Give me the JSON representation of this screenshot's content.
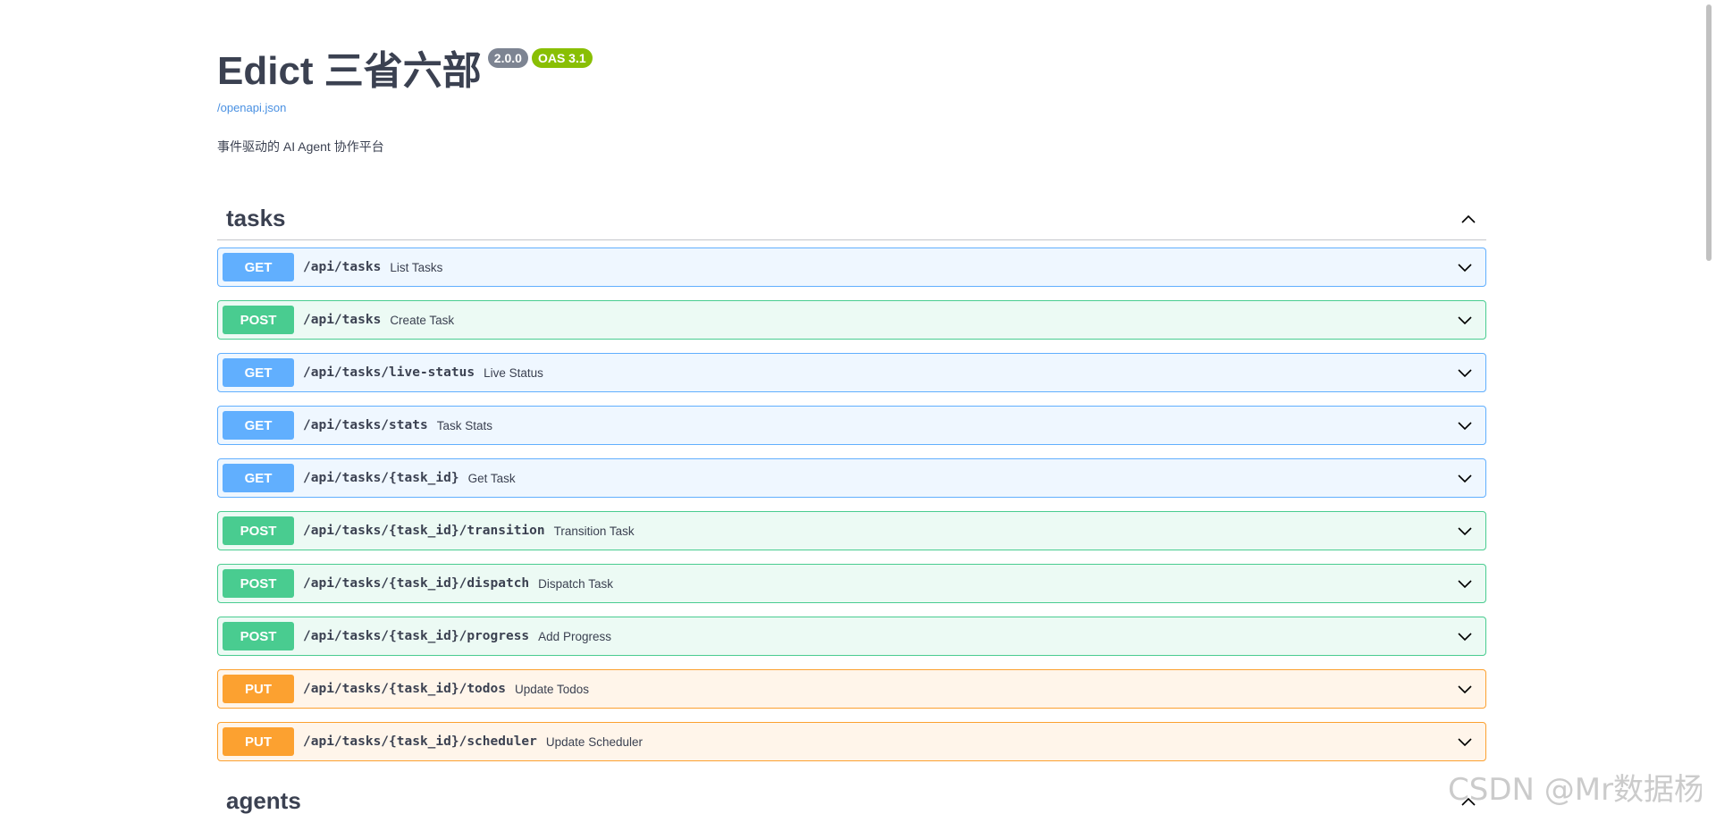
{
  "info": {
    "title": "Edict 三省六部",
    "version_badge": "2.0.0",
    "oas_badge": "OAS 3.1",
    "spec_link": "/openapi.json",
    "description": "事件驱动的 AI Agent 协作平台"
  },
  "tags": [
    {
      "name": "tasks",
      "operations": [
        {
          "method": "GET",
          "path": "/api/tasks",
          "summary": "List Tasks"
        },
        {
          "method": "POST",
          "path": "/api/tasks",
          "summary": "Create Task"
        },
        {
          "method": "GET",
          "path": "/api/tasks/live-status",
          "summary": "Live Status"
        },
        {
          "method": "GET",
          "path": "/api/tasks/stats",
          "summary": "Task Stats"
        },
        {
          "method": "GET",
          "path": "/api/tasks/{task_id}",
          "summary": "Get Task"
        },
        {
          "method": "POST",
          "path": "/api/tasks/{task_id}/transition",
          "summary": "Transition Task"
        },
        {
          "method": "POST",
          "path": "/api/tasks/{task_id}/dispatch",
          "summary": "Dispatch Task"
        },
        {
          "method": "POST",
          "path": "/api/tasks/{task_id}/progress",
          "summary": "Add Progress"
        },
        {
          "method": "PUT",
          "path": "/api/tasks/{task_id}/todos",
          "summary": "Update Todos"
        },
        {
          "method": "PUT",
          "path": "/api/tasks/{task_id}/scheduler",
          "summary": "Update Scheduler"
        }
      ]
    },
    {
      "name": "agents",
      "operations": []
    }
  ],
  "watermark": "CSDN @Mr数据杨",
  "colors": {
    "get": "#61affe",
    "post": "#49cc90",
    "put": "#fca130",
    "version_badge": "#7d8492",
    "oas_badge": "#89bf04",
    "link": "#4990e2"
  },
  "icons": {
    "collapse": "chevron-up-icon",
    "expand": "chevron-down-icon"
  }
}
